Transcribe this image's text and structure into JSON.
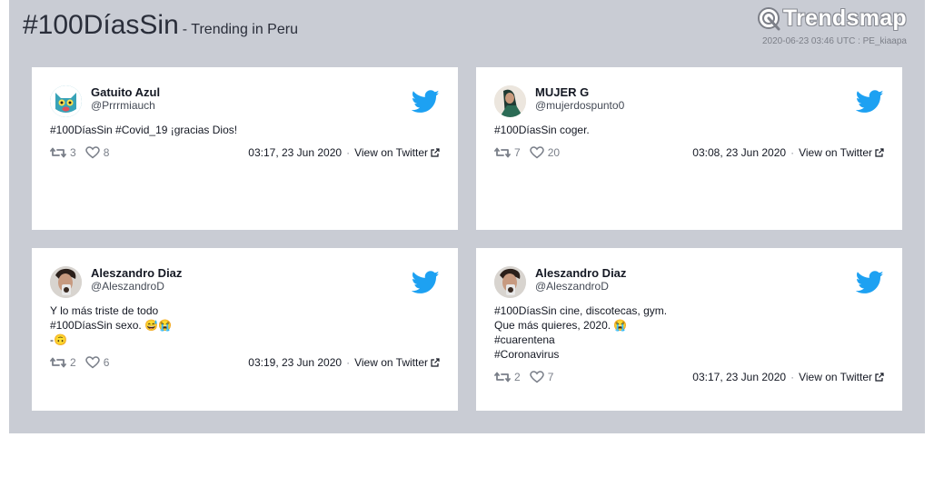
{
  "header": {
    "hashtag": "#100DíasSin",
    "subtitle": "- Trending in Peru",
    "brand": "Trendsmap",
    "timestamp": "2020-06-23 03:46 UTC : PE_kiaapa"
  },
  "tweets": [
    {
      "name": "Gatuito Azul",
      "handle": "@Prrrmiauch",
      "lines": [
        "#100DíasSin #Covid_19 ¡gracias Dios!"
      ],
      "retweets": "3",
      "likes": "8",
      "time": "03:17, 23 Jun 2020",
      "view": "View on Twitter"
    },
    {
      "name": "MUJER G",
      "handle": "@mujerdospunto0",
      "lines": [
        "#100DíasSin coger."
      ],
      "retweets": "7",
      "likes": "20",
      "time": "03:08, 23 Jun 2020",
      "view": "View on Twitter"
    },
    {
      "name": "Aleszandro Diaz",
      "handle": "@AleszandroD",
      "lines": [
        "Y lo más triste de todo",
        "#100DíasSin sexo. 😅😭",
        "-🙃"
      ],
      "retweets": "2",
      "likes": "6",
      "time": "03:19, 23 Jun 2020",
      "view": "View on Twitter"
    },
    {
      "name": "Aleszandro Diaz",
      "handle": "@AleszandroD",
      "lines": [
        "#100DíasSin cine, discotecas, gym.",
        "Que más quieres, 2020. 😭",
        "#cuarentena",
        "#Coronavirus"
      ],
      "retweets": "2",
      "likes": "7",
      "time": "03:17, 23 Jun 2020",
      "view": "View on Twitter"
    }
  ],
  "colors": {
    "panel": "#c9ccd4",
    "twitter_blue": "#1da1f2",
    "text": "#141823"
  },
  "icons": [
    "trendsmap-logo-icon",
    "twitter-bird-icon",
    "retweet-icon",
    "heart-icon",
    "external-link-icon"
  ]
}
